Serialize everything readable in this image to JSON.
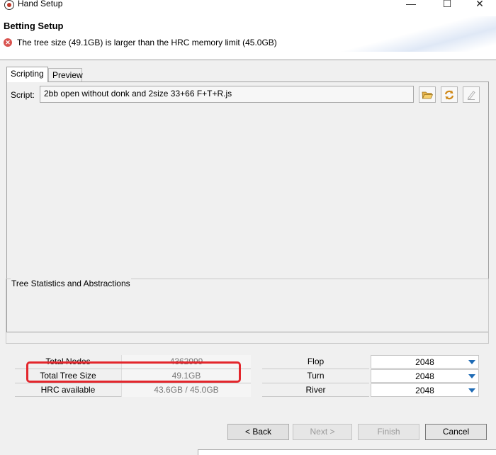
{
  "window": {
    "title": "Hand Setup",
    "controls": {
      "minimize": "—",
      "maximize": "☐",
      "close": "✕"
    }
  },
  "header": {
    "title": "Betting Setup",
    "error_message": "The tree size (49.1GB) is larger than the HRC memory limit (45.0GB)"
  },
  "tabs": [
    {
      "label": "Scripting",
      "active": true
    },
    {
      "label": "Preview",
      "active": false
    }
  ],
  "script": {
    "label": "Script:",
    "value": "2bb open without donk and 2size 33+66 F+T+R.js",
    "icons": [
      "open-folder-icon",
      "reload-icon",
      "edit-icon"
    ]
  },
  "stats": {
    "title": "Tree Statistics and Abstractions",
    "rows": [
      {
        "label": "Total Nodes",
        "value": "4362999"
      },
      {
        "label": "Total Tree Size",
        "value": "49.1GB"
      },
      {
        "label": "HRC available",
        "value": "43.6GB / 45.0GB"
      }
    ],
    "abstractions": [
      {
        "street": "Flop",
        "value": "2048"
      },
      {
        "street": "Turn",
        "value": "2048"
      },
      {
        "street": "River",
        "value": "2048"
      }
    ]
  },
  "buttons": {
    "back": "< Back",
    "next": "Next >",
    "finish": "Finish",
    "cancel": "Cancel"
  },
  "colors": {
    "highlight": "#e3262c",
    "error": "#d9534f",
    "dropdown_caret": "#1f6bb5"
  }
}
